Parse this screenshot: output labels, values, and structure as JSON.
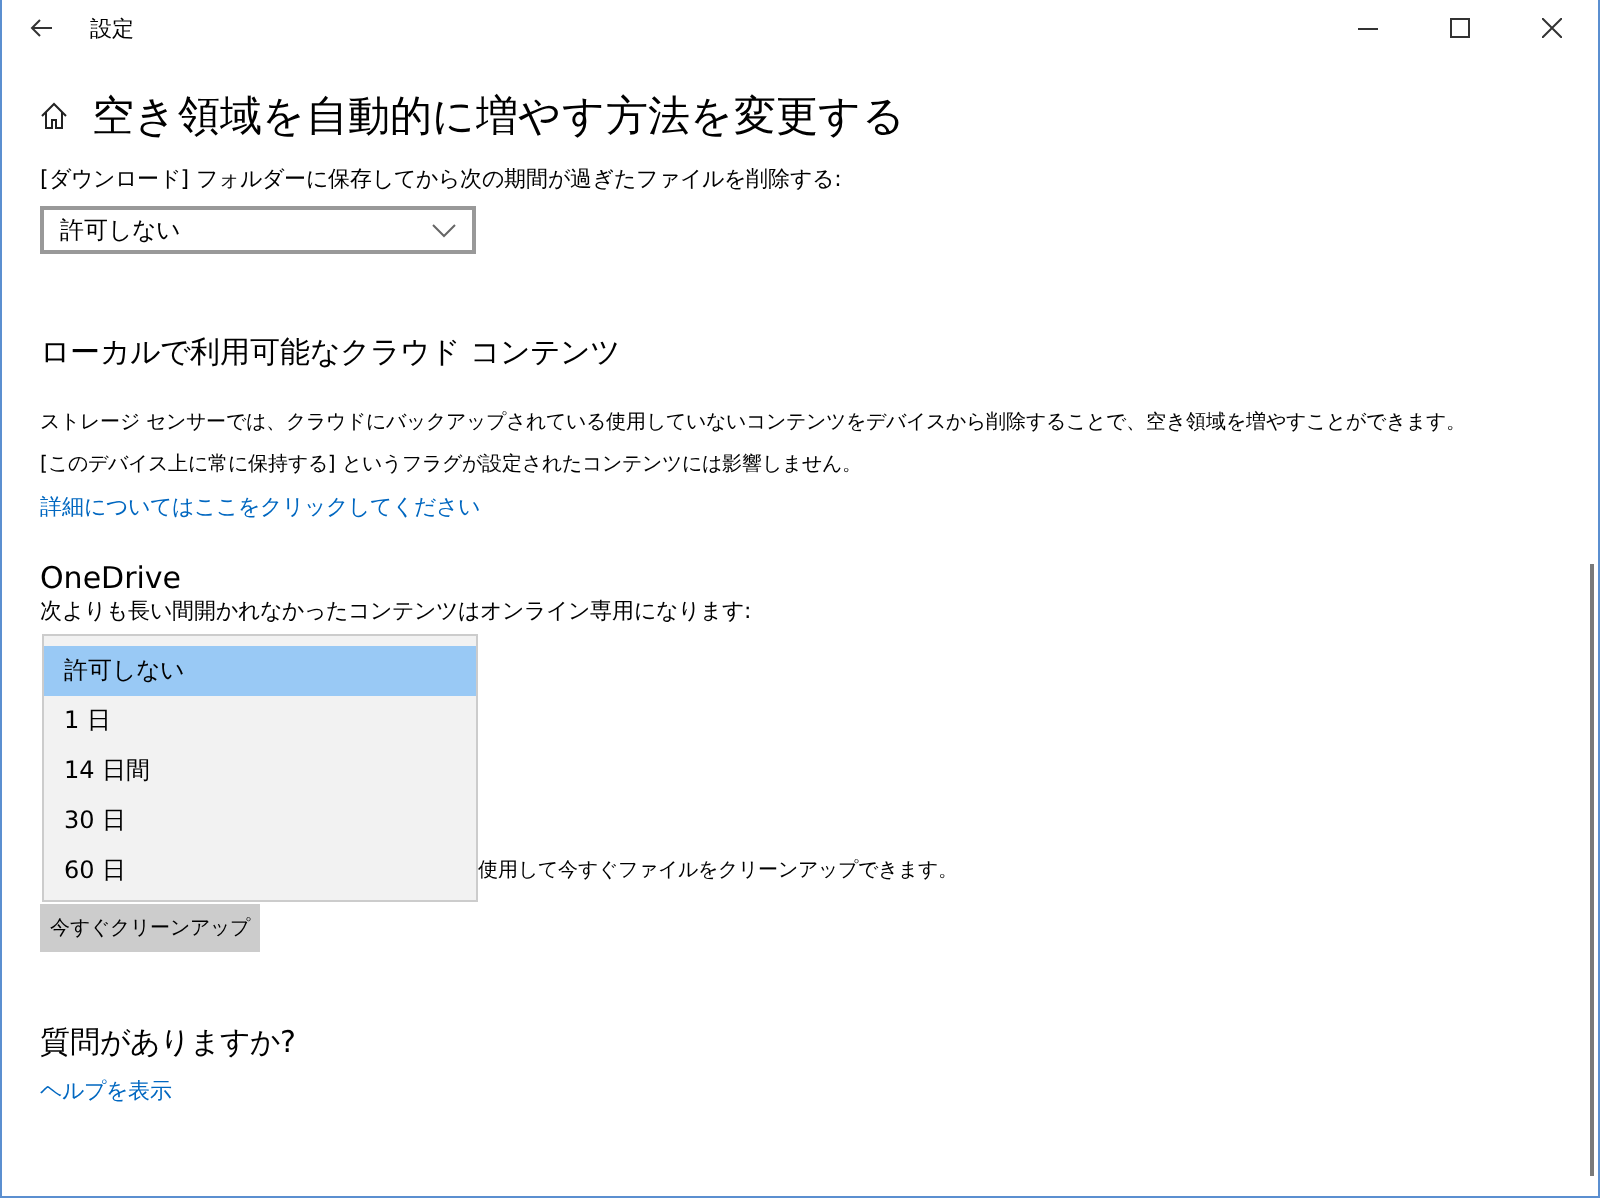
{
  "window": {
    "title": "設定"
  },
  "page": {
    "title": "空き領域を自動的に増やす方法を変更する"
  },
  "downloads": {
    "label": "[ダウンロード] フォルダーに保存してから次の期間が過ぎたファイルを削除する:",
    "value": "許可しない"
  },
  "cloud_section": {
    "heading": "ローカルで利用可能なクラウド コンテンツ",
    "paragraphs": [
      "ストレージ センサーでは、クラウドにバックアップされている使用していないコンテンツをデバイスから削除することで、空き領域を増やすことができます。",
      "[このデバイス上に常に保持する] というフラグが設定されたコンテンツには影響しません。"
    ],
    "link": "詳細についてはここをクリックしてください"
  },
  "onedrive": {
    "heading": "OneDrive",
    "label": "次よりも長い間開かれなかったコンテンツはオンライン専用になります:",
    "options": [
      {
        "label": "許可しない",
        "selected": true
      },
      {
        "label": "1 日",
        "selected": false
      },
      {
        "label": "14 日間",
        "selected": false
      },
      {
        "label": "30 日",
        "selected": false
      },
      {
        "label": "60 日",
        "selected": false
      }
    ]
  },
  "cleanup": {
    "text": "使用して今すぐファイルをクリーンアップできます。",
    "button": "今すぐクリーンアップ"
  },
  "questions": {
    "heading": "質問がありますか?",
    "link": "ヘルプを表示"
  }
}
